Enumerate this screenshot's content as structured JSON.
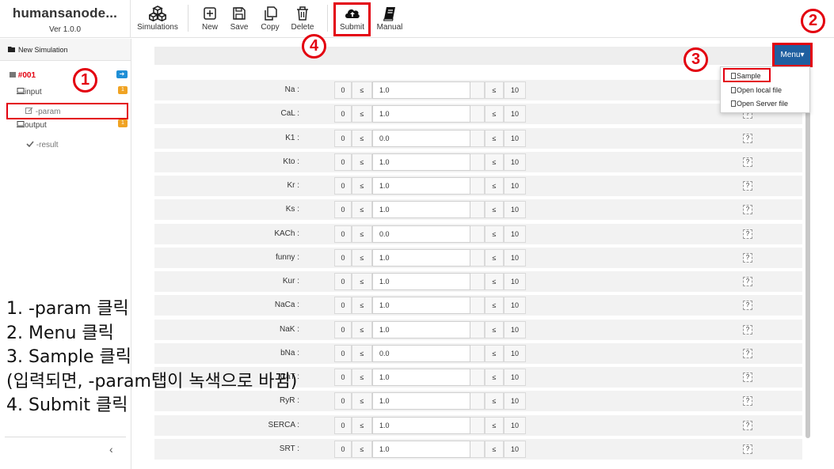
{
  "app": {
    "title": "humansanode...",
    "version": "Ver 1.0.0"
  },
  "toolbar": {
    "simulations": "Simulations",
    "new": "New",
    "save": "Save",
    "copy": "Copy",
    "delete": "Delete",
    "submit": "Submit",
    "manual": "Manual"
  },
  "sidebar": {
    "new_simulation": "New Simulation",
    "sim_id": "#001",
    "sim_badge": "➔",
    "input_label": "input",
    "input_badge": "1",
    "param_label": "-param",
    "output_label": "output",
    "output_badge": "1",
    "result_label": "-result",
    "collapse": "‹"
  },
  "menu": {
    "label": "Menu▾",
    "items": [
      "Sample",
      "Open local file",
      "Open Server file"
    ]
  },
  "params": [
    {
      "name": "Na :",
      "min": "0",
      "op": "≤",
      "value": "1.0",
      "op2": "≤",
      "max": "10"
    },
    {
      "name": "CaL :",
      "min": "0",
      "op": "≤",
      "value": "1.0",
      "op2": "≤",
      "max": "10"
    },
    {
      "name": "K1 :",
      "min": "0",
      "op": "≤",
      "value": "0.0",
      "op2": "≤",
      "max": "10"
    },
    {
      "name": "Kto :",
      "min": "0",
      "op": "≤",
      "value": "1.0",
      "op2": "≤",
      "max": "10"
    },
    {
      "name": "Kr :",
      "min": "0",
      "op": "≤",
      "value": "1.0",
      "op2": "≤",
      "max": "10"
    },
    {
      "name": "Ks :",
      "min": "0",
      "op": "≤",
      "value": "1.0",
      "op2": "≤",
      "max": "10"
    },
    {
      "name": "KACh :",
      "min": "0",
      "op": "≤",
      "value": "0.0",
      "op2": "≤",
      "max": "10"
    },
    {
      "name": "funny :",
      "min": "0",
      "op": "≤",
      "value": "1.0",
      "op2": "≤",
      "max": "10"
    },
    {
      "name": "Kur :",
      "min": "0",
      "op": "≤",
      "value": "1.0",
      "op2": "≤",
      "max": "10"
    },
    {
      "name": "NaCa :",
      "min": "0",
      "op": "≤",
      "value": "1.0",
      "op2": "≤",
      "max": "10"
    },
    {
      "name": "NaK :",
      "min": "0",
      "op": "≤",
      "value": "1.0",
      "op2": "≤",
      "max": "10"
    },
    {
      "name": "bNa :",
      "min": "0",
      "op": "≤",
      "value": "0.0",
      "op2": "≤",
      "max": "10"
    },
    {
      "name": "CaT :",
      "min": "0",
      "op": "≤",
      "value": "1.0",
      "op2": "≤",
      "max": "10"
    },
    {
      "name": "RyR :",
      "min": "0",
      "op": "≤",
      "value": "1.0",
      "op2": "≤",
      "max": "10"
    },
    {
      "name": "SERCA :",
      "min": "0",
      "op": "≤",
      "value": "1.0",
      "op2": "≤",
      "max": "10"
    },
    {
      "name": "SRT :",
      "min": "0",
      "op": "≤",
      "value": "1.0",
      "op2": "≤",
      "max": "10"
    }
  ],
  "help_label": "?",
  "callouts": {
    "c1": "1",
    "c2": "2",
    "c3": "3",
    "c4": "4"
  },
  "instructions": [
    "1. -param 클릭",
    "2. Menu 클릭",
    "3. Sample 클릭",
    "(입력되면, -param탭이 녹색으로 바뀜)",
    "4. Submit 클릭"
  ],
  "colors": {
    "highlight": "#e3000f",
    "menu_button": "#1f5fa0",
    "badge_orange": "#f0a323",
    "badge_blue": "#1f8fd6"
  }
}
